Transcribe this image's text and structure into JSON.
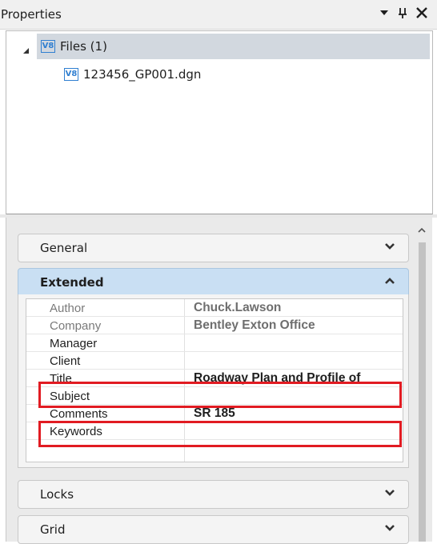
{
  "panel": {
    "title": "Properties",
    "controls": {
      "dropdown": "▼",
      "pin": "ᵖ",
      "close": "✕"
    }
  },
  "tree": {
    "root": {
      "icon": "V8",
      "label": "Files (1)",
      "expanded": true,
      "selected": true
    },
    "children": [
      {
        "icon": "V8",
        "label": "123456_GP001.dgn"
      }
    ]
  },
  "sections": {
    "general": {
      "label": "General",
      "expanded": false
    },
    "extended": {
      "label": "Extended",
      "expanded": true
    },
    "locks": {
      "label": "Locks",
      "expanded": false
    },
    "grid": {
      "label": "Grid",
      "expanded": false
    }
  },
  "extended_rows": [
    {
      "key": "Author",
      "value": "Chuck.Lawson",
      "readonly": true
    },
    {
      "key": "Company",
      "value": "Bentley Exton Office",
      "readonly": true
    },
    {
      "key": "Manager",
      "value": ""
    },
    {
      "key": "Client",
      "value": ""
    },
    {
      "key": "Title",
      "value": "Roadway Plan and Profile of"
    },
    {
      "key": "Subject",
      "value": ""
    },
    {
      "key": "Comments",
      "value": "SR 185"
    },
    {
      "key": "Keywords",
      "value": ""
    }
  ],
  "colors": {
    "highlight": "#e11b22",
    "icon_blue": "#2f7fd1",
    "section_open": "#c9dff3",
    "selected_row": "#d2d8df"
  }
}
